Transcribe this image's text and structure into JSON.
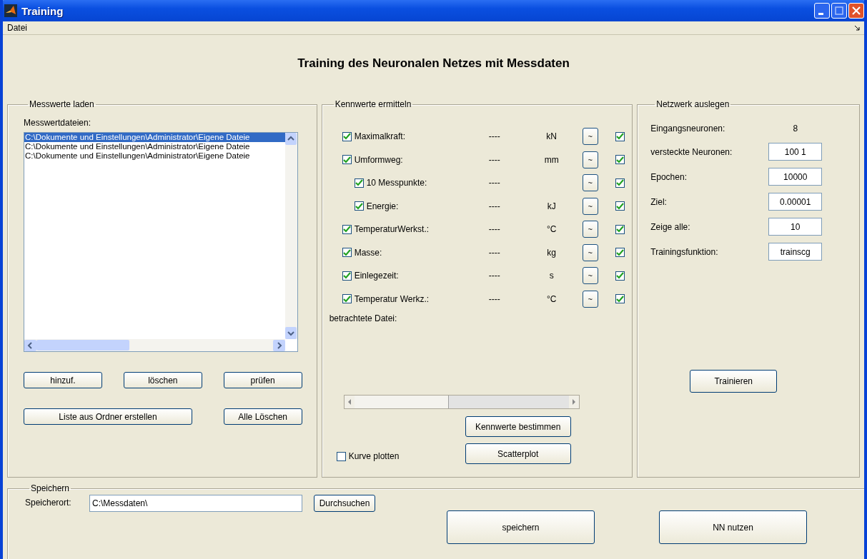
{
  "window": {
    "title": "Training"
  },
  "menu": [
    "Datei"
  ],
  "heading": "Training des Neuronalen Netzes mit Messdaten",
  "load_panel": {
    "title": "Messwerte laden",
    "list_label": "Messwertdateien:",
    "files": [
      {
        "path": "C:\\Dokumente und Einstellungen\\Administrator\\Eigene Dateie",
        "selected": true
      },
      {
        "path": "C:\\Dokumente und Einstellungen\\Administrator\\Eigene Dateie",
        "selected": false
      },
      {
        "path": "C:\\Dokumente und Einstellungen\\Administrator\\Eigene Dateie",
        "selected": false
      }
    ],
    "buttons": [
      "hinzuf.",
      "löschen",
      "prüfen"
    ],
    "buttons_2": [
      "Liste aus Ordner erstellen",
      "Alle Löschen"
    ]
  },
  "features_panel": {
    "title": "Kennwerte ermitteln",
    "rows": [
      {
        "label": "Maximalkraft:",
        "value": "----",
        "unit": "kN",
        "button": "~",
        "checked": true,
        "use": true
      },
      {
        "label": "Umformweg:",
        "value": "----",
        "unit": "mm",
        "button": "~",
        "checked": true,
        "use": true,
        "children": [
          {
            "label": "10 Messpunkte:",
            "value": "----",
            "button": "~",
            "checked": true,
            "use": true
          },
          {
            "label": "Energie:",
            "value": "----",
            "unit": "kJ",
            "button": "~",
            "checked": true,
            "use": true
          }
        ]
      },
      {
        "label": "TemperaturWerkst.:",
        "value": "----",
        "unit": "°C",
        "button": "~",
        "checked": true,
        "use": true
      },
      {
        "label": "Masse:",
        "value": "----",
        "unit": "kg",
        "button": "~",
        "checked": true,
        "use": true
      },
      {
        "label": "Einlegezeit:",
        "value": "----",
        "unit": "s",
        "button": "~",
        "checked": true,
        "use": true
      },
      {
        "label": "Temperatur Werkz.:",
        "value": "----",
        "unit": "°C",
        "button": "~",
        "checked": true,
        "use": true
      }
    ],
    "file_label": "betrachtete Datei:",
    "slider": {
      "level": 0
    },
    "buttons": [
      "Kennwerte bestimmen",
      "Scatterplot"
    ],
    "plot_option": {
      "label": "Kurve plotten",
      "checked": false
    }
  },
  "network_panel": {
    "title": "Netzwerk auslegen",
    "fields": [
      {
        "label": "Eingangsneuronen:",
        "value": "8",
        "kind": "text"
      },
      {
        "label": "versteckte Neuronen:",
        "value": "100 1",
        "kind": "input"
      },
      {
        "label": "Epochen:",
        "value": "10000",
        "kind": "input"
      },
      {
        "label": "Ziel:",
        "value": "0.00001",
        "kind": "input"
      },
      {
        "label": "Zeige alle:",
        "value": "10",
        "kind": "input"
      },
      {
        "label": "Trainingsfunktion:",
        "value": "trainscg",
        "kind": "input"
      }
    ],
    "button": "Trainieren"
  },
  "save_panel": {
    "title": "Speichern",
    "location_label": "Speicherort:",
    "location": "C:\\Messdaten\\",
    "browse": "Durchsuchen",
    "buttons": [
      "speichern",
      "NN nutzen"
    ]
  }
}
